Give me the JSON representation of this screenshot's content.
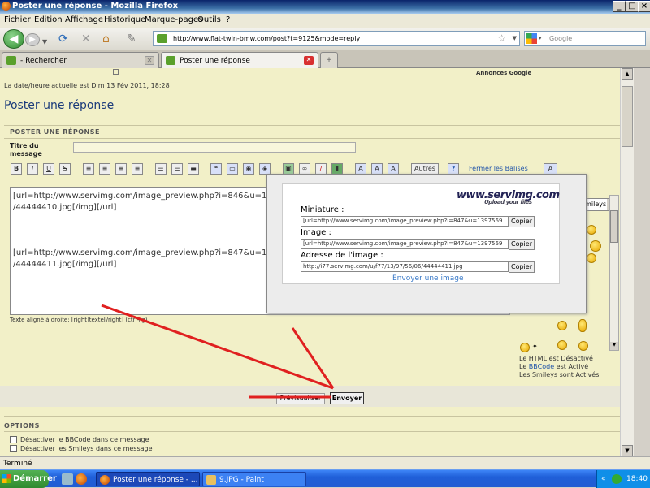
{
  "window": {
    "title": "Poster une réponse - Mozilla Firefox",
    "min": "_",
    "max": "□",
    "close": "×"
  },
  "menu": [
    "Fichier",
    "Edition",
    "Affichage",
    "Historique",
    "Marque-pages",
    "Outils",
    "?"
  ],
  "nav": {
    "url": "http://www.flat-twin-bmw.com/post?t=9125&mode=reply",
    "search_placeholder": "Google"
  },
  "tabs": [
    {
      "label": "- Rechercher",
      "active": false
    },
    {
      "label": "Poster une réponse",
      "active": true
    }
  ],
  "tab_new": "+",
  "page": {
    "ads": "Annonces Google",
    "datetime": "La date/heure actuelle est Dim 13 Fév 2011, 18:28",
    "title": "Poster une réponse",
    "section": "POSTER UNE RÉPONSE",
    "subject_label_1": "Titre du",
    "subject_label_2": "message",
    "toolbar": {
      "bold": "B",
      "italic": "I",
      "underline": "U",
      "strike": "S",
      "autres": "Autres",
      "help": "?",
      "close_tags": "Fermer les Balises",
      "font_size": "A"
    },
    "help_line": "Texte aligné à droite: [right]texte[/right] (ctrl+g)",
    "message_lines": [
      "[url=http://www.servimg.com/image_preview.php?i=846&u=13",
      "/44444410.jpg[/img][/url]",
      "[url=http://www.servimg.com/image_preview.php?i=847&u=13",
      "/44444411.jpg[/img][/url]"
    ],
    "smileys_select": "Smileys",
    "html_status": "Le HTML est Désactivé",
    "bbcode_status_pre": "Le",
    "bbcode_status_link": "BBCode",
    "bbcode_status_post": "est Activé",
    "smileys_status": "Les Smileys sont Activés",
    "preview_button": "Prévisualiser",
    "send_button": "Envoyer",
    "options_header": "OPTIONS",
    "options": [
      "Désactiver le BBCode dans ce message",
      "Désactiver les Smileys dans ce message"
    ]
  },
  "popup": {
    "brand": "www.servimg.com",
    "tagline": "Upload your files",
    "thumb_label": "Miniature :",
    "thumb_value": "[url=http://www.servimg.com/image_preview.php?i=847&u=1397569",
    "image_label": "Image :",
    "image_value": "[url=http://www.servimg.com/image_preview.php?i=847&u=1397569",
    "address_label": "Adresse de l'image :",
    "address_value": "http://i77.servimg.com/u/f77/13/97/56/06/44444411.jpg",
    "copy": "Copier",
    "send_image": "Envoyer une image"
  },
  "status": "Terminé",
  "taskbar": {
    "start": "Démarrer",
    "tasks": [
      "Poster une réponse - ...",
      "9.JPG - Paint"
    ],
    "clock": "18:40",
    "tray_arrow": "«"
  },
  "colors": {
    "page_bg": "#f2f0c8",
    "title_blue": "#1a3a7a",
    "link": "#2255aa",
    "annotation_red": "#e02020"
  }
}
